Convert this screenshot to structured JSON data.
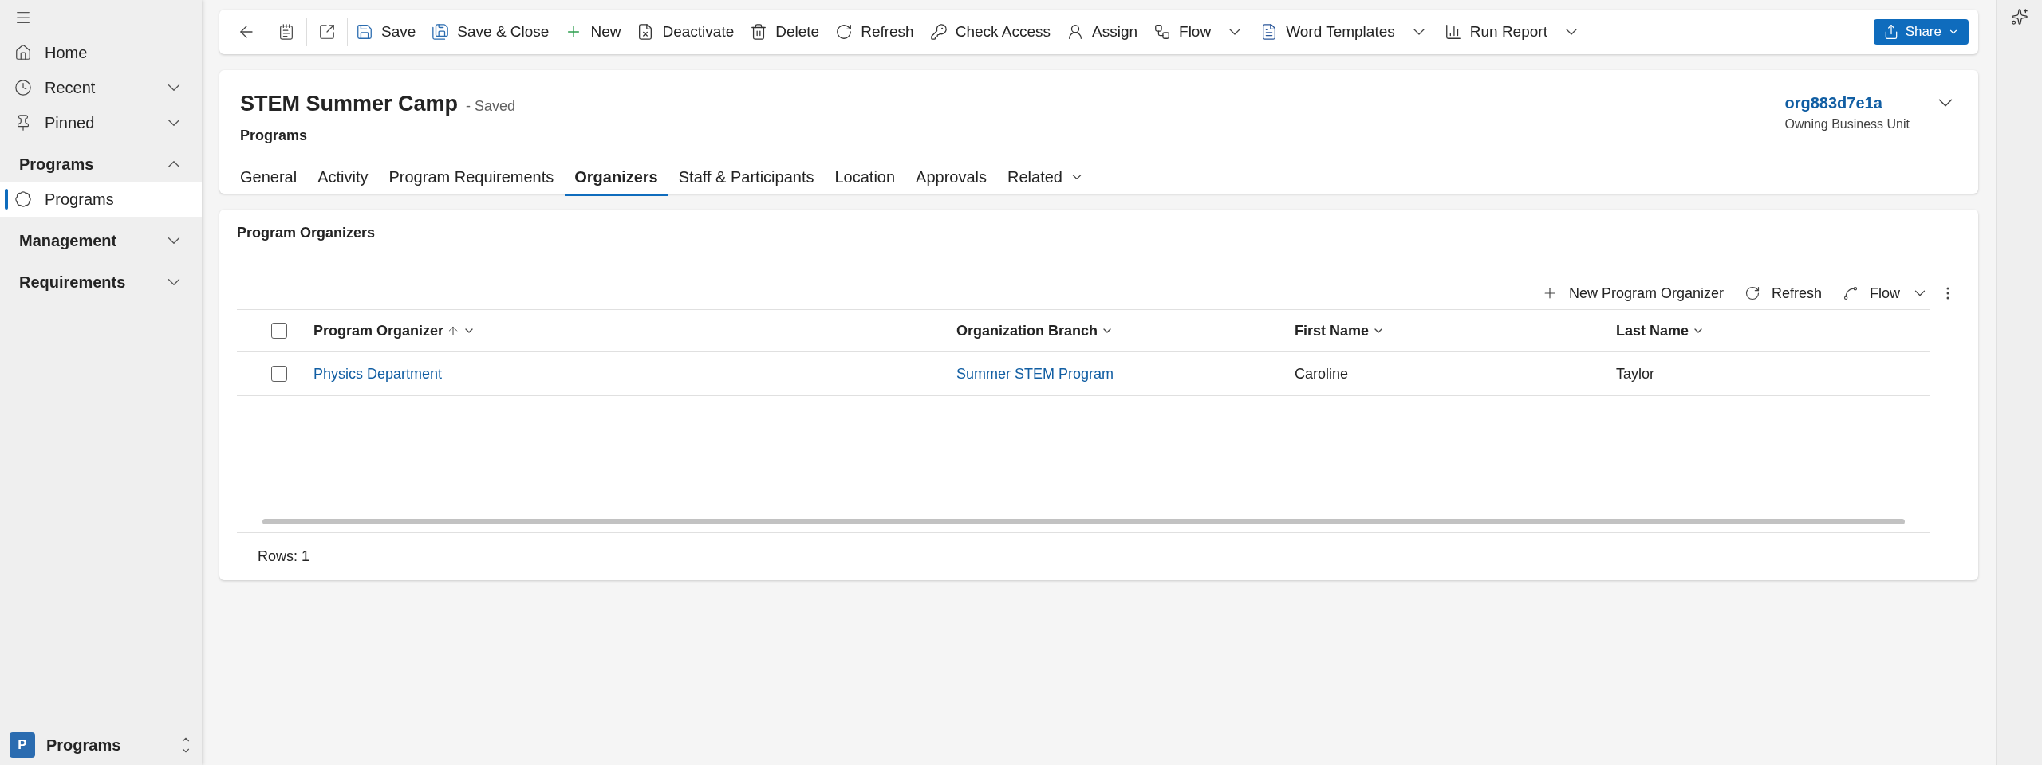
{
  "nav": {
    "items": [
      {
        "kind": "link",
        "label": "Home",
        "selected": false
      },
      {
        "kind": "link",
        "label": "Recent",
        "expanded": false,
        "selected": false
      },
      {
        "kind": "link",
        "label": "Pinned",
        "expanded": false,
        "selected": false
      },
      {
        "kind": "group",
        "label": "Programs",
        "expanded": true,
        "selected": false
      },
      {
        "kind": "subitem",
        "label": "Programs",
        "selected": true
      },
      {
        "kind": "group",
        "label": "Management",
        "expanded": false,
        "selected": false
      },
      {
        "kind": "group",
        "label": "Requirements",
        "expanded": false,
        "selected": false
      }
    ],
    "app": {
      "badge": "P",
      "name": "Programs"
    }
  },
  "toolbar": {
    "items": [
      {
        "label": "Save",
        "dropdown": false
      },
      {
        "label": "Save & Close",
        "dropdown": false
      },
      {
        "label": "New",
        "dropdown": false
      },
      {
        "label": "Deactivate",
        "dropdown": false
      },
      {
        "label": "Delete",
        "dropdown": false
      },
      {
        "label": "Refresh",
        "dropdown": false
      },
      {
        "label": "Check Access",
        "dropdown": false
      },
      {
        "label": "Assign",
        "dropdown": false
      },
      {
        "label": "Flow",
        "dropdown": true
      },
      {
        "label": "Word Templates",
        "dropdown": true
      },
      {
        "label": "Run Report",
        "dropdown": true
      }
    ],
    "share": "Share"
  },
  "record": {
    "title": "STEM Summer Camp",
    "status": "- Saved",
    "entity": "Programs",
    "owner": "org883d7e1a",
    "owner_label": "Owning Business Unit"
  },
  "tabs": [
    {
      "label": "General",
      "selected": false,
      "dropdown": false
    },
    {
      "label": "Activity",
      "selected": false,
      "dropdown": false
    },
    {
      "label": "Program Requirements",
      "selected": false,
      "dropdown": false
    },
    {
      "label": "Organizers",
      "selected": true,
      "dropdown": false
    },
    {
      "label": "Staff & Participants",
      "selected": false,
      "dropdown": false
    },
    {
      "label": "Location",
      "selected": false,
      "dropdown": false
    },
    {
      "label": "Approvals",
      "selected": false,
      "dropdown": false
    },
    {
      "label": "Related",
      "selected": false,
      "dropdown": true
    }
  ],
  "subgrid": {
    "title": "Program Organizers",
    "commands": [
      {
        "label": "New Program Organizer",
        "dropdown": false
      },
      {
        "label": "Refresh",
        "dropdown": false
      },
      {
        "label": "Flow",
        "dropdown": true
      }
    ],
    "columns": [
      {
        "label": "Program Organizer",
        "sorted": true
      },
      {
        "label": "Organization Branch",
        "sorted": false
      },
      {
        "label": "First Name",
        "sorted": false
      },
      {
        "label": "Last Name",
        "sorted": false
      }
    ],
    "rows": [
      {
        "checked": false,
        "cells": [
          {
            "text": "Physics Department",
            "kind": "link"
          },
          {
            "text": "Summer STEM Program",
            "kind": "link"
          },
          {
            "text": "Caroline",
            "kind": "text"
          },
          {
            "text": "Taylor",
            "kind": "text"
          }
        ]
      }
    ],
    "header_checked": false,
    "footer": "Rows: 1"
  }
}
